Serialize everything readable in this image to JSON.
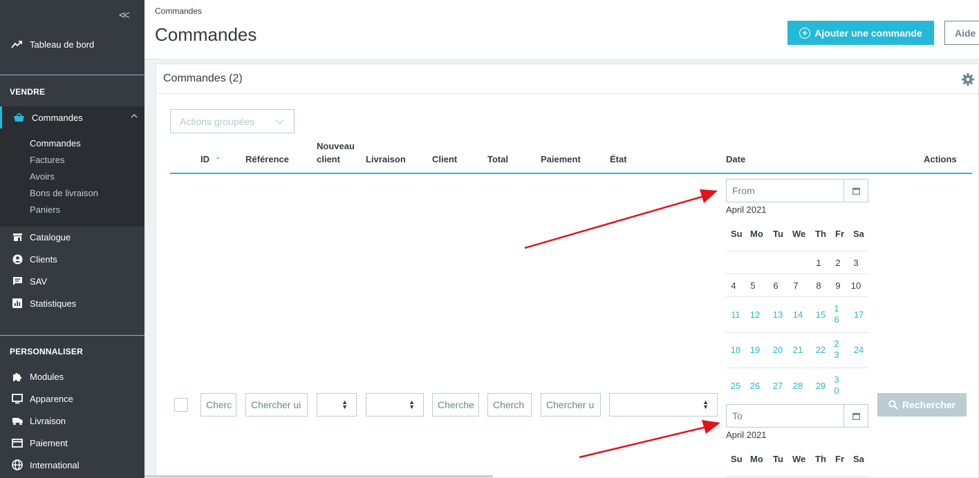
{
  "sidebar": {
    "collapse_label": "<<",
    "dashboard": "Tableau de bord",
    "section_sell": "VENDRE",
    "orders": "Commandes",
    "orders_sub": [
      "Commandes",
      "Factures",
      "Avoirs",
      "Bons de livraison",
      "Paniers"
    ],
    "items_sell": [
      "Catalogue",
      "Clients",
      "SAV",
      "Statistiques"
    ],
    "section_custom": "PERSONNALISER",
    "items_custom": [
      "Modules",
      "Apparence",
      "Livraison",
      "Paiement",
      "International"
    ]
  },
  "header": {
    "breadcrumb": "Commandes",
    "title": "Commandes",
    "add_button": "Ajouter une commande",
    "help_button": "Aide"
  },
  "card": {
    "title": "Commandes (2)",
    "bulk_actions": "Actions groupées"
  },
  "table": {
    "headers": {
      "id": "ID",
      "reference": "Référence",
      "new_client_1": "Nouveau",
      "new_client_2": "client",
      "delivery": "Livraison",
      "client": "Client",
      "total": "Total",
      "payment": "Paiement",
      "state": "État",
      "date": "Date",
      "actions": "Actions"
    },
    "filters": {
      "id": "Cherc",
      "reference": "Chercher ui",
      "client": "Cherche",
      "total": "Cherch",
      "payment": "Chercher u"
    },
    "search_button": "Rechercher"
  },
  "datepicker": {
    "from_placeholder": "From",
    "to_placeholder": "To",
    "month": "April 2021",
    "weekdays": [
      "Su",
      "Mo",
      "Tu",
      "We",
      "Th",
      "Fr",
      "Sa"
    ],
    "week1": [
      "",
      "",
      "",
      "",
      "1",
      "2",
      "3"
    ],
    "week2": [
      "4",
      "5",
      "6",
      "7",
      "8",
      "9",
      "10"
    ],
    "week3": [
      "11",
      "12",
      "13",
      "14",
      "15",
      "1\n6",
      "17"
    ],
    "week4": [
      "18",
      "19",
      "20",
      "21",
      "22",
      "2\n3",
      "24"
    ],
    "week5": [
      "25",
      "26",
      "27",
      "28",
      "29",
      "3\n0",
      ""
    ]
  },
  "colors": {
    "accent": "#25b9d7",
    "sidebar_bg": "#363a41",
    "arrow": "#e3121b"
  }
}
